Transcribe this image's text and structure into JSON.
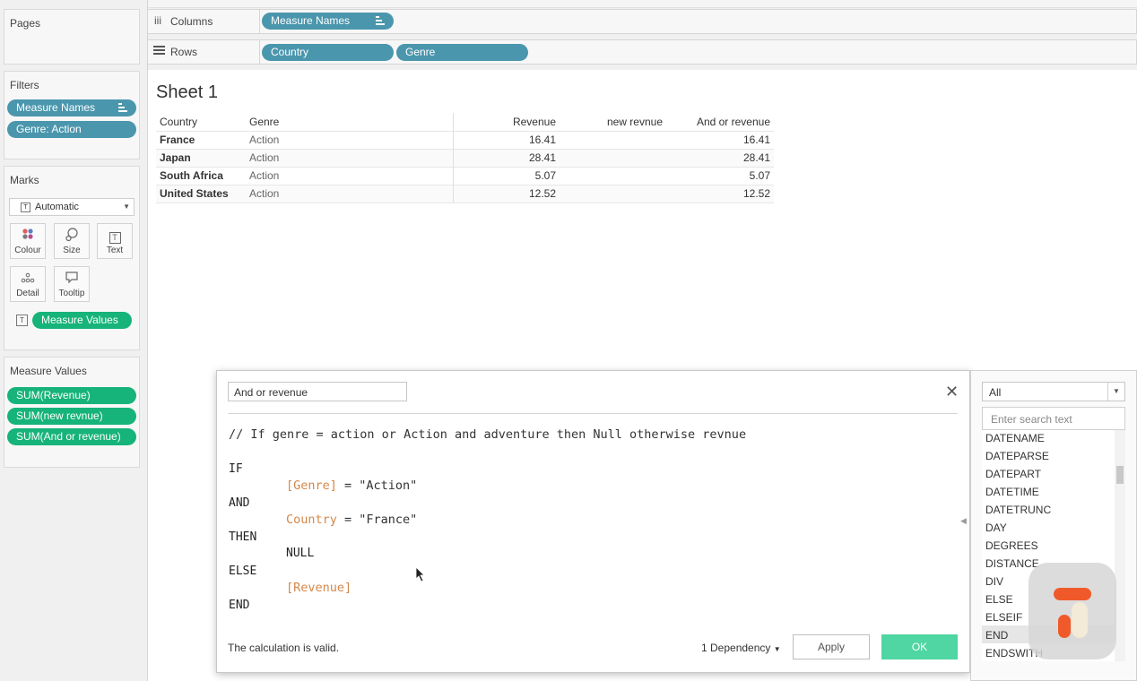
{
  "left_panel": {
    "pages_title": "Pages",
    "filters_title": "Filters",
    "filters": [
      "Measure Names",
      "Genre: Action"
    ],
    "marks_title": "Marks",
    "mark_type": "Automatic",
    "mark_buttons": [
      "Colour",
      "Size",
      "Text",
      "Detail",
      "Tooltip"
    ],
    "marks_pill": "Measure Values",
    "measure_values_title": "Measure Values",
    "measure_values": [
      "SUM(Revenue)",
      "SUM(new revnue)",
      "SUM(And or revenue)"
    ]
  },
  "shelves": {
    "columns_label": "Columns",
    "columns_pills": [
      "Measure Names"
    ],
    "rows_label": "Rows",
    "rows_pills": [
      "Country",
      "Genre"
    ]
  },
  "sheet": {
    "title": "Sheet 1",
    "headers": [
      "Country",
      "Genre",
      "Revenue",
      "new revnue",
      "And or revenue"
    ],
    "rows": [
      {
        "country": "France",
        "genre": "Action",
        "revenue": "16.41",
        "new": "",
        "and_or": "16.41"
      },
      {
        "country": "Japan",
        "genre": "Action",
        "revenue": "28.41",
        "new": "",
        "and_or": "28.41"
      },
      {
        "country": "South Africa",
        "genre": "Action",
        "revenue": "5.07",
        "new": "",
        "and_or": "5.07"
      },
      {
        "country": "United States",
        "genre": "Action",
        "revenue": "12.52",
        "new": "",
        "and_or": "12.52"
      }
    ]
  },
  "calc_dialog": {
    "name": "And or revenue",
    "comment": "// If genre = action or Action and adventure then Null otherwise revnue",
    "kw_if": "IF",
    "genre_field": "[Genre]",
    "genre_cond": " = \"Action\"",
    "kw_and": "AND",
    "country_field": "Country",
    "country_cond": " = \"France\"",
    "kw_then": "THEN",
    "null_text": "NULL",
    "kw_else": "ELSE",
    "revenue_field": "[Revenue]",
    "kw_end": "END",
    "status": "The calculation is valid.",
    "dependency": "1 Dependency",
    "apply": "Apply",
    "ok": "OK"
  },
  "function_panel": {
    "category": "All",
    "search_placeholder": "Enter search text",
    "functions": [
      "DATENAME",
      "DATEPARSE",
      "DATEPART",
      "DATETIME",
      "DATETRUNC",
      "DAY",
      "DEGREES",
      "DISTANCE",
      "DIV",
      "ELSE",
      "ELSEIF",
      "END",
      "ENDSWITH"
    ],
    "selected": "END"
  },
  "colors": {
    "blue_pill": "#4a96ad",
    "green_pill": "#16b37a",
    "ok_button": "#4fd6a2",
    "field_orange": "#d4884a"
  },
  "icons": {
    "columns": "columns-icon",
    "rows": "rows-icon",
    "close": "close-icon",
    "dropdown": "chevron-down-icon"
  }
}
